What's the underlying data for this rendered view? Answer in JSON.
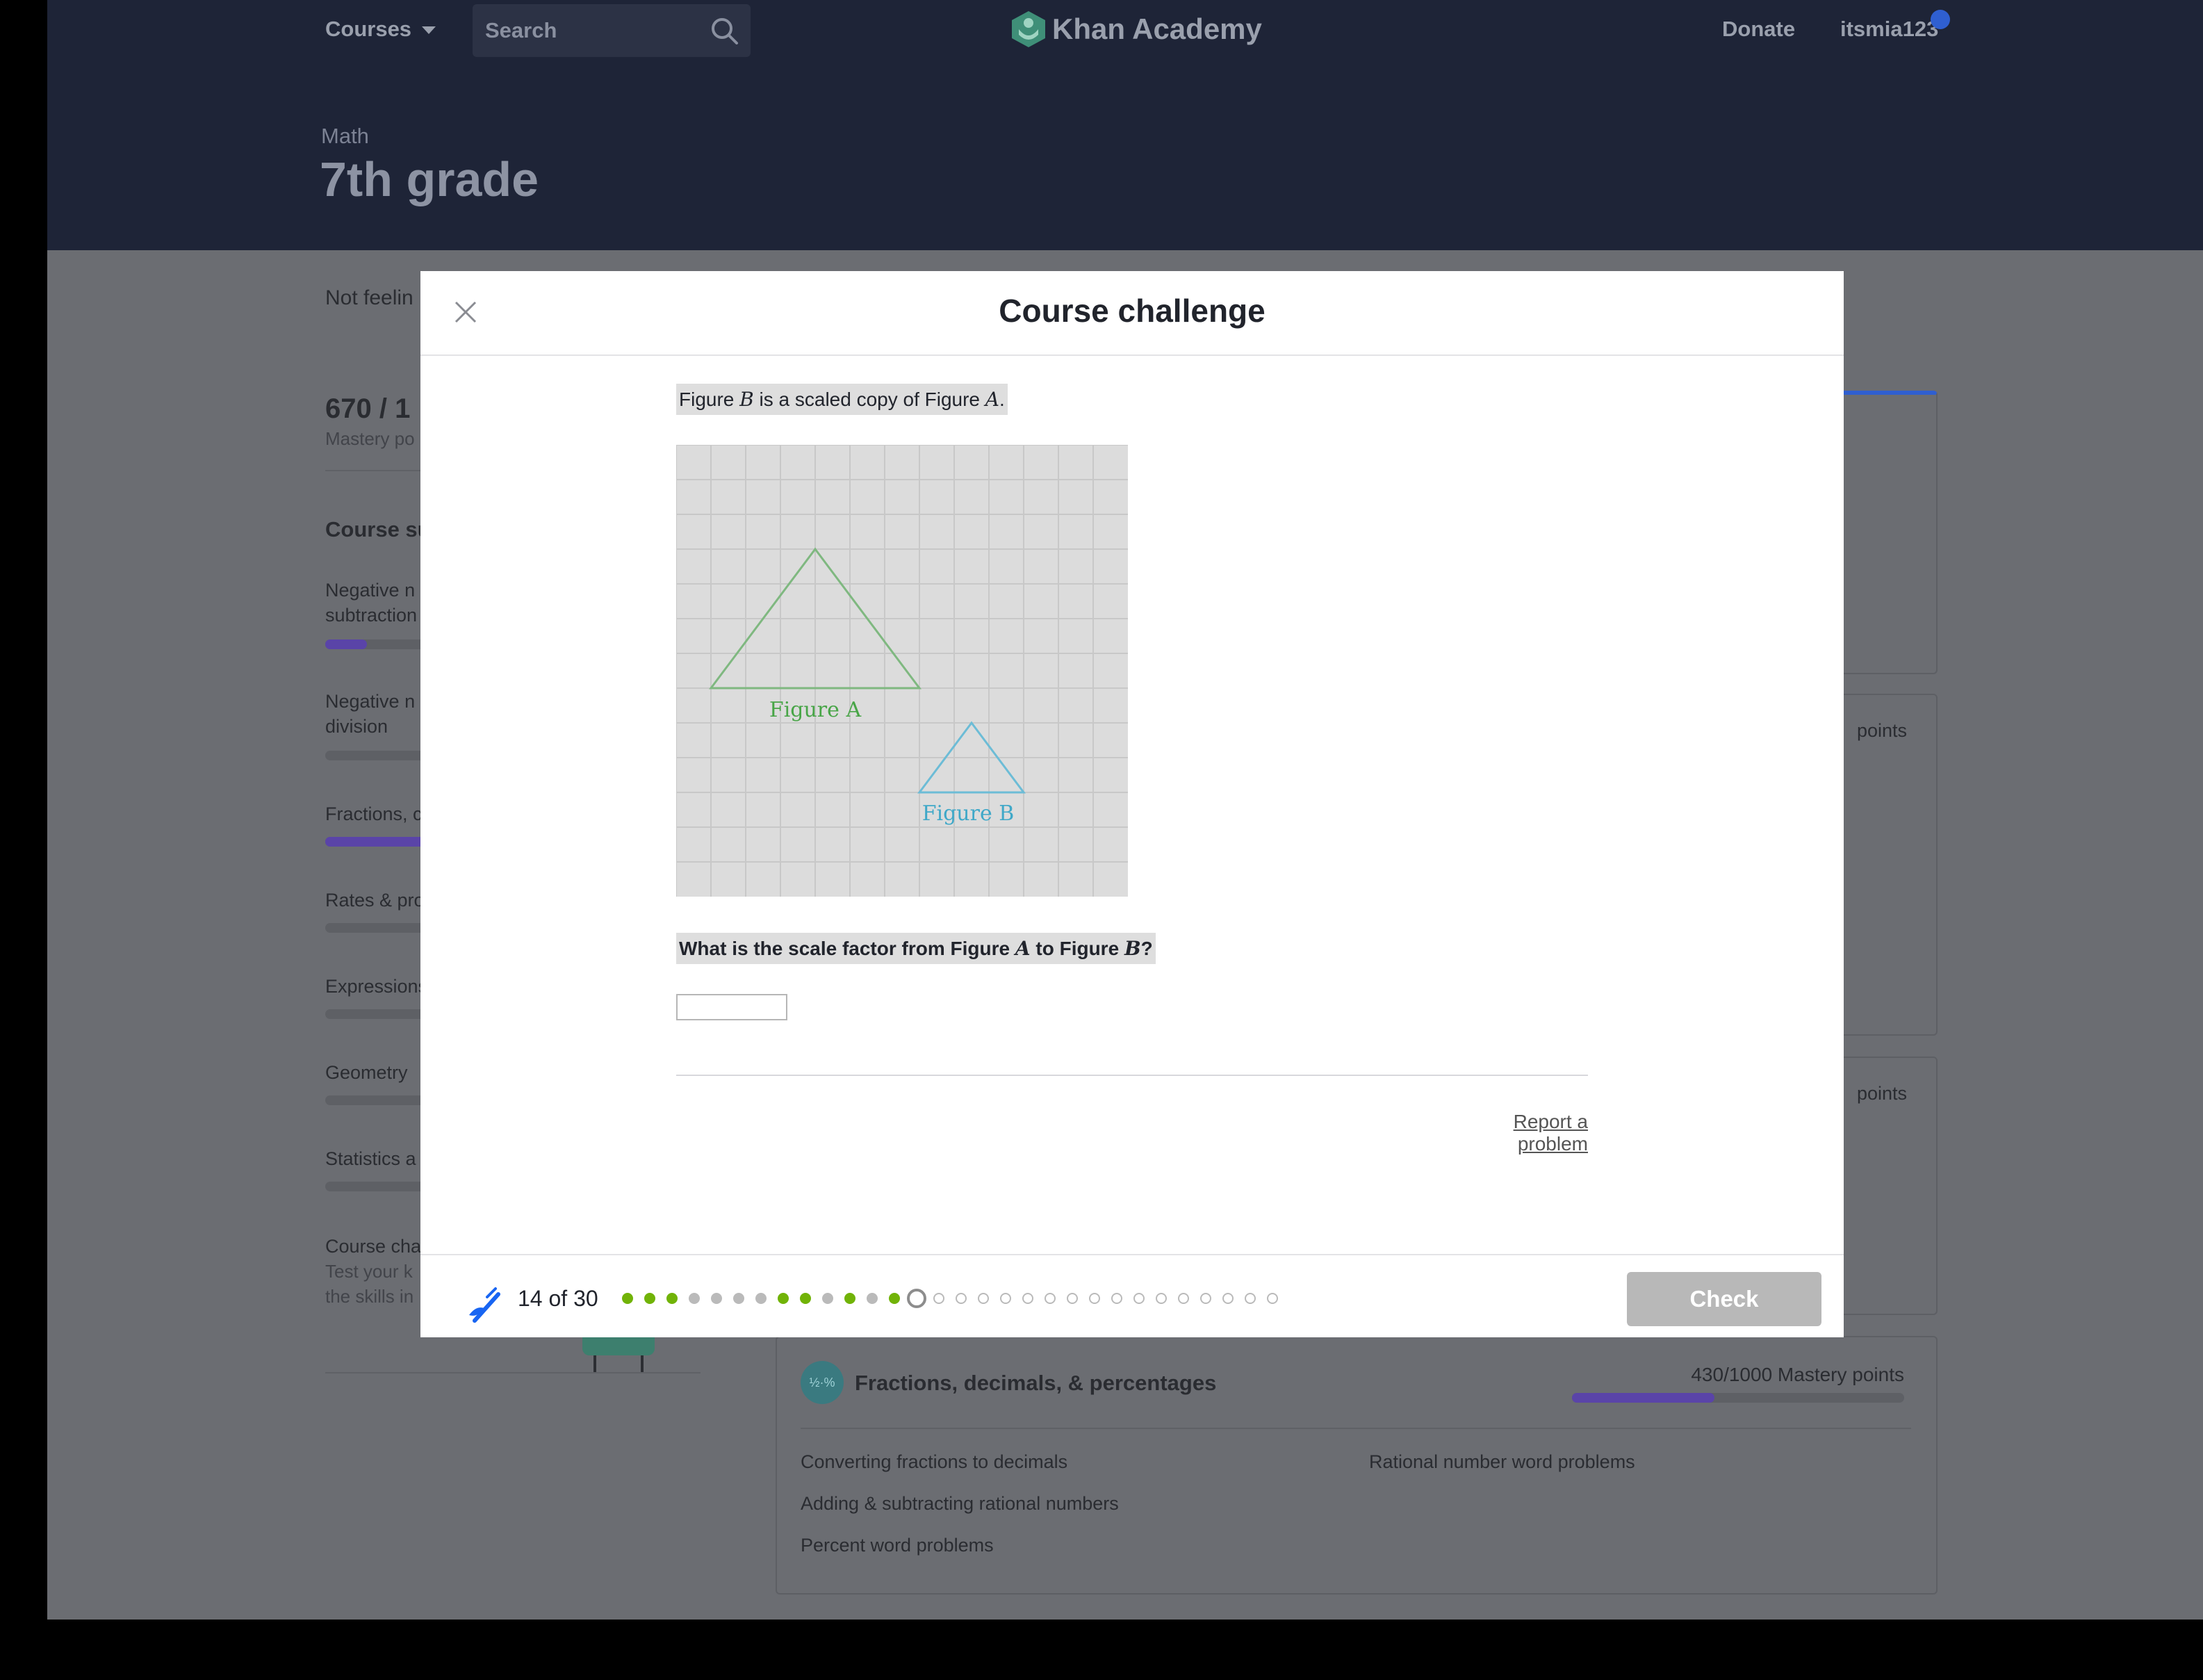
{
  "nav": {
    "courses": "Courses",
    "search_placeholder": "Search",
    "logo": "Khan Academy",
    "donate": "Donate",
    "username": "itsmia123"
  },
  "hero": {
    "subject": "Math",
    "grade": "7th grade"
  },
  "background": {
    "banner": "Not feelin",
    "score": "670 / 1",
    "score_label": "Mastery po",
    "summary_title": "Course su",
    "units": [
      {
        "line1": "Negative n",
        "line2": "subtraction",
        "progress": 0.4
      },
      {
        "line1": "Negative n",
        "line2": "division",
        "progress": 0.0
      },
      {
        "line1": "Fractions, c",
        "line2": "",
        "progress": 0.9
      },
      {
        "line1": "Rates & pro",
        "line2": "",
        "progress": 0.0
      },
      {
        "line1": "Expressions",
        "line2": "",
        "progress": 0.0
      },
      {
        "line1": "Geometry",
        "line2": "",
        "progress": 0.0
      },
      {
        "line1": "Statistics a",
        "line2": "",
        "progress": 0.0
      }
    ],
    "course_challenge": {
      "title": "Course cha",
      "line2": "Test your k",
      "line3": "the skills in"
    },
    "points_fragment": "points",
    "fractions_card": {
      "icon_text": "½·%",
      "title": "Fractions, decimals, & percentages",
      "mastery": "430/1000 Mastery points",
      "mastery_progress": 0.43,
      "skills": [
        "Converting fractions to decimals",
        "Rational number word problems",
        "Adding & subtracting rational numbers",
        "Percent word problems"
      ]
    }
  },
  "modal": {
    "title": "Course challenge",
    "prompt_pre": "Figure ",
    "prompt_var1": "B",
    "prompt_mid": " is a scaled copy of Figure ",
    "prompt_var2": "A",
    "prompt_post": ".",
    "figure": {
      "label_a": "Figure A",
      "label_b": "Figure B",
      "color_a": "#7fb880",
      "color_b": "#6cbcd6",
      "label_a_color": "#48a547",
      "label_b_color": "#3fa8c8",
      "grid_cells": 12
    },
    "question_pre": "What is the scale factor from Figure ",
    "question_var1": "A",
    "question_mid": " to Figure ",
    "question_var2": "B",
    "question_post": "?",
    "answer_value": "",
    "report": "Report a problem",
    "counter": "14 of 30",
    "dots": [
      "correct",
      "correct",
      "correct",
      "skipped",
      "skipped",
      "skipped",
      "skipped",
      "correct",
      "correct",
      "skipped",
      "correct",
      "skipped",
      "correct",
      "current",
      "todo",
      "todo",
      "todo",
      "todo",
      "todo",
      "todo",
      "todo",
      "todo",
      "todo",
      "todo",
      "todo",
      "todo",
      "todo",
      "todo",
      "todo",
      "todo"
    ],
    "check": "Check"
  }
}
